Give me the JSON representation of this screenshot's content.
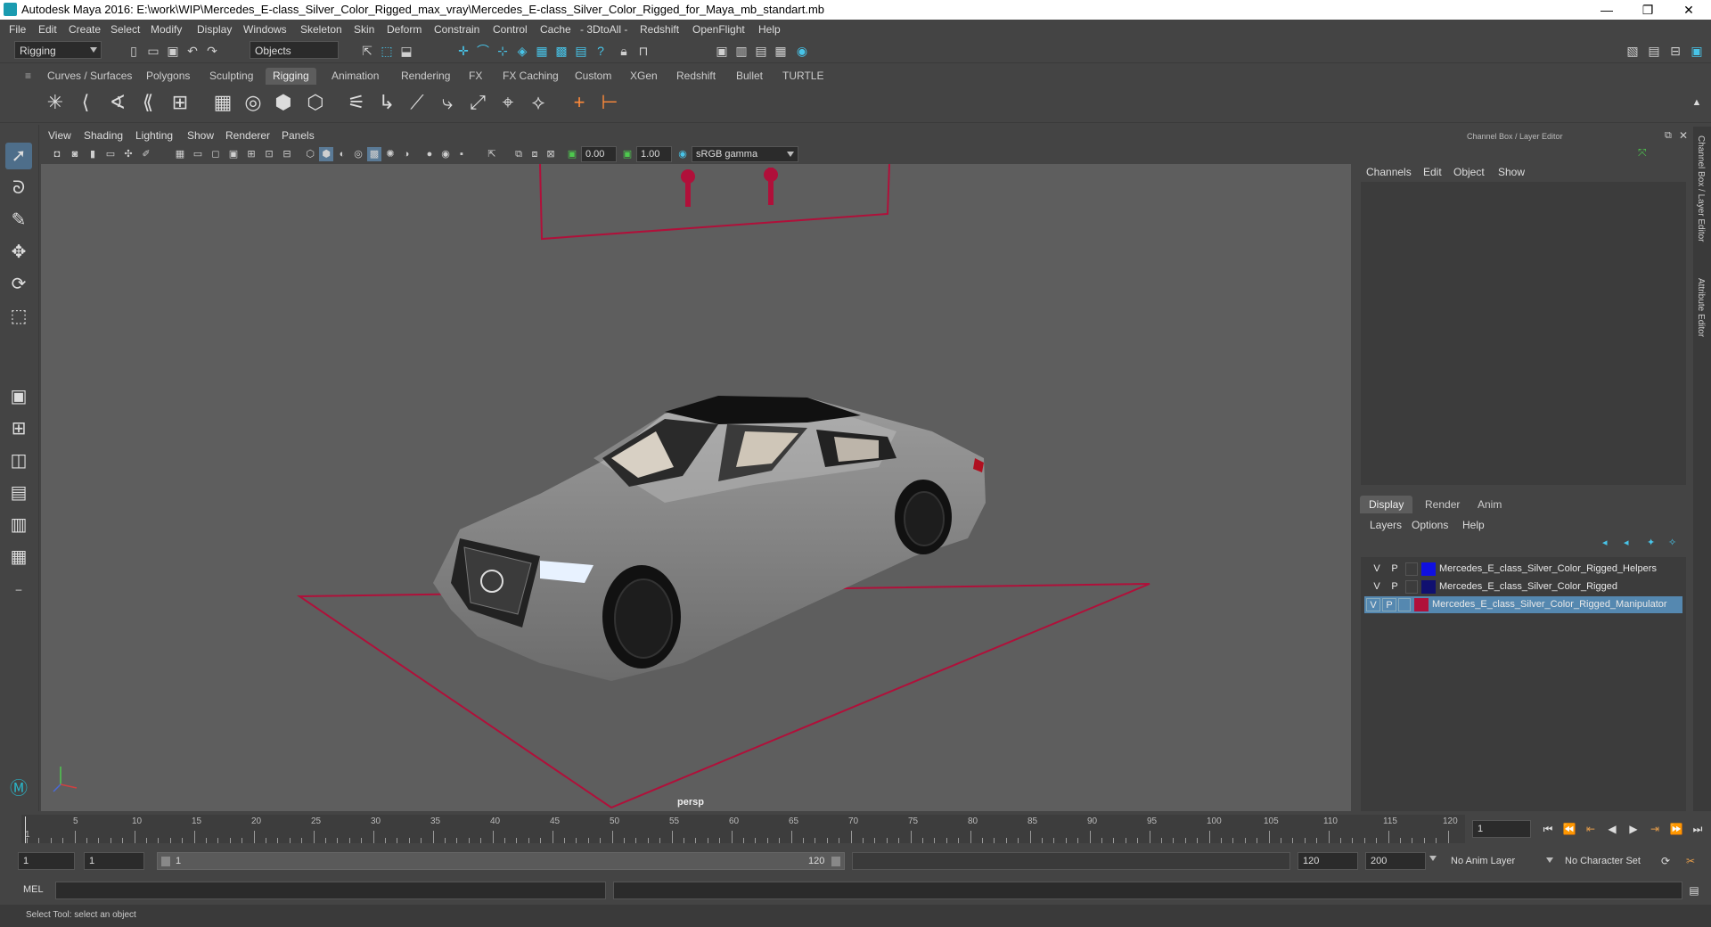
{
  "title": "Autodesk Maya 2016: E:\\work\\WIP\\Mercedes_E-class_Silver_Color_Rigged_max_vray\\Mercedes_E-class_Silver_Color_Rigged_for_Maya_mb_standart.mb",
  "menus": [
    "File",
    "Edit",
    "Create",
    "Select",
    "Modify",
    "Display",
    "Windows",
    "Skeleton",
    "Skin",
    "Deform",
    "Constrain",
    "Control",
    "Cache",
    "- 3DtoAll -",
    "Redshift",
    "OpenFlight",
    "Help"
  ],
  "status": {
    "menuset": "Rigging",
    "selmode": "Objects"
  },
  "shelf_tabs": [
    "Curves / Surfaces",
    "Polygons",
    "Sculpting",
    "Rigging",
    "Animation",
    "Rendering",
    "FX",
    "FX Caching",
    "Custom",
    "XGen",
    "Redshift",
    "Bullet",
    "TURTLE"
  ],
  "active_shelf": "Rigging",
  "panel_menus": [
    "View",
    "Shading",
    "Lighting",
    "Show",
    "Renderer",
    "Panels"
  ],
  "panel_fields": {
    "exposure": "0.00",
    "gamma": "1.00",
    "colorspace": "sRGB gamma"
  },
  "viewport": {
    "camera": "persp"
  },
  "channel_box": {
    "title": "Channel Box / Layer Editor",
    "menus": [
      "Channels",
      "Edit",
      "Object",
      "Show"
    ],
    "layer_tabs": [
      "Display",
      "Render",
      "Anim"
    ],
    "active_layer_tab": "Display",
    "layer_menus": [
      "Layers",
      "Options",
      "Help"
    ],
    "layers": [
      {
        "v": "V",
        "p": "P",
        "name": "Mercedes_E_class_Silver_Color_Rigged_Helpers",
        "color": "#1010e0"
      },
      {
        "v": "V",
        "p": "P",
        "name": "Mercedes_E_class_Silver_Color_Rigged",
        "color": "#101070"
      },
      {
        "v": "V",
        "p": "P",
        "name": "Mercedes_E_class_Silver_Color_Rigged_Manipulator",
        "color": "#b0103a"
      }
    ]
  },
  "side_tabs": [
    "Channel Box / Layer Editor",
    "Attribute Editor"
  ],
  "timeline": {
    "ticks": [
      "1",
      "5",
      "10",
      "15",
      "20",
      "25",
      "30",
      "35",
      "40",
      "45",
      "50",
      "55",
      "60",
      "65",
      "70",
      "75",
      "80",
      "85",
      "90",
      "95",
      "100",
      "105",
      "110",
      "115",
      "120"
    ],
    "current_frame": "1"
  },
  "range": {
    "start": "1",
    "playback_start": "1",
    "slider_start": "1",
    "slider_end": "120",
    "playback_end": "120",
    "end": "200",
    "anim_layer": "No Anim Layer",
    "character_set": "No Character Set"
  },
  "mel": {
    "label": "MEL"
  },
  "help_line": "Select Tool: select an object",
  "colors": {
    "accent": "#5588b0",
    "manipulator": "#b0103a",
    "bg": "#444444"
  }
}
